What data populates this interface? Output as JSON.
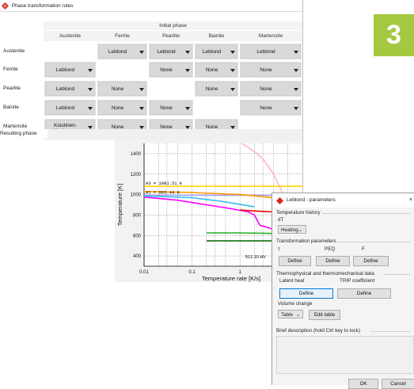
{
  "window": {
    "title": "Phase transformation rules"
  },
  "badge": "3",
  "table": {
    "initial_phase_label": "Initial phase",
    "columns": [
      "Austenite",
      "Ferrite",
      "Pearlite",
      "Bainite",
      "Martensite"
    ],
    "rows": [
      {
        "label": "Austenite",
        "cells": [
          "",
          "Leblond",
          "Leblond",
          "Leblond",
          "Leblond"
        ]
      },
      {
        "label": "Ferrite",
        "cells": [
          "Leblond",
          "",
          "None",
          "None",
          "None"
        ]
      },
      {
        "label": "Pearlite",
        "cells": [
          "Leblond",
          "None",
          "",
          "None",
          "None"
        ]
      },
      {
        "label": "Bainite",
        "cells": [
          "Leblond",
          "None",
          "None",
          "",
          "None"
        ]
      },
      {
        "label": "Martensite",
        "cells": [
          "Koistinen-Marburger",
          "None",
          "None",
          "None",
          ""
        ]
      }
    ],
    "resulting_phase_label": "Resulting phase"
  },
  "chart_data": {
    "type": "line",
    "xlabel": "Temperature rate [K/s]",
    "ylabel": "Temperature [K]",
    "x_scale": "log",
    "x_ticks": [
      "0.01",
      "0.1",
      "1",
      "10"
    ],
    "y_ticks": [
      "400",
      "600",
      "800",
      "1000",
      "1200",
      "1400"
    ],
    "xlim": [
      0.01,
      20
    ],
    "ylim": [
      300,
      1500
    ],
    "grid": true,
    "annotations": [
      "A3 = 1081.51 K",
      "A1 = 993.44 K",
      "512.10 HV"
    ],
    "series": [
      {
        "color": "#ffd200",
        "x": [
          0.01,
          20
        ],
        "y": [
          1081,
          1081
        ]
      },
      {
        "color": "#a0a0ff",
        "x": [
          0.01,
          20
        ],
        "y": [
          993,
          993
        ]
      },
      {
        "color": "#ffb6c1",
        "x": [
          1.1,
          2,
          3,
          5,
          8,
          12
        ],
        "y": [
          1500,
          1420,
          1350,
          1200,
          1000,
          800
        ]
      },
      {
        "color": "#ff9900",
        "x": [
          0.01,
          0.1,
          1,
          3,
          8,
          15
        ],
        "y": [
          1030,
          1020,
          1000,
          980,
          960,
          950
        ]
      },
      {
        "color": "#ff00ff",
        "x": [
          0.01,
          0.05,
          0.2,
          0.7,
          1.5,
          2,
          2.6,
          5,
          8
        ],
        "y": [
          975,
          945,
          900,
          860,
          830,
          800,
          700,
          660,
          650
        ]
      },
      {
        "color": "#33bbee",
        "x": [
          0.01,
          0.1,
          0.4,
          1,
          2
        ],
        "y": [
          985,
          970,
          935,
          905,
          880
        ]
      },
      {
        "color": "#e60000",
        "x": [
          1,
          2,
          5,
          10,
          20
        ],
        "y": [
          850,
          840,
          830,
          830,
          830
        ]
      },
      {
        "color": "#1db31d",
        "x": [
          0.2,
          1,
          5,
          10,
          20
        ],
        "y": [
          625,
          625,
          620,
          620,
          625
        ]
      },
      {
        "color": "#00c040",
        "x": [
          5,
          10,
          20
        ],
        "y": [
          640,
          650,
          665
        ]
      },
      {
        "color": "#006400",
        "x": [
          0.2,
          1,
          5,
          10,
          20
        ],
        "y": [
          548,
          548,
          548,
          548,
          550
        ]
      }
    ]
  },
  "dialog": {
    "title": "Leblond - parameters",
    "close": "×",
    "temp_history": "Temperature history",
    "dT": "dT",
    "heating": "Heating",
    "trans_params": "Transformation parameters",
    "tau": "τ",
    "peq": "PEQ",
    "f": "F",
    "define": "Define",
    "thermo": "Thermophysical and thermomechanical data",
    "latent_heat": "Latent heat",
    "trip": "TRIP coefficient",
    "volume_change": "Volume change",
    "table": "Table",
    "edit_table": "Edit table",
    "brief": "Brief description (hold Ctrl key to lock)",
    "ok": "OK",
    "cancel": "Cancel"
  }
}
